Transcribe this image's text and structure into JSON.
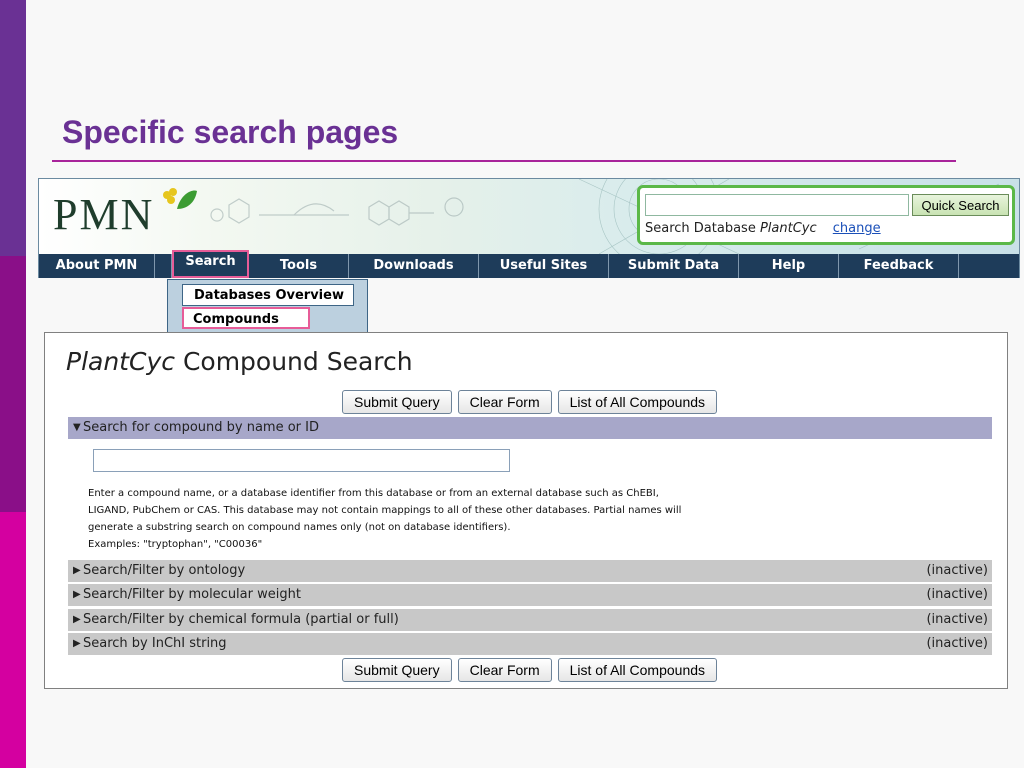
{
  "slide": {
    "title": "Specific search pages"
  },
  "pmn": {
    "logo": "PMN",
    "quick_search": {
      "input_value": "",
      "button_label": "Quick Search",
      "db_prefix": "Search Database",
      "db_name": "PlantCyc",
      "change_label": "change"
    },
    "nav": [
      "About PMN",
      "Search",
      "Tools",
      "Downloads",
      "Useful Sites",
      "Submit Data",
      "Help",
      "Feedback"
    ],
    "dropdown": {
      "item1": "Databases Overview",
      "item2": "Compounds"
    }
  },
  "compound_search": {
    "title_italic": "PlantCyc",
    "title_rest": "Compound Search",
    "buttons": {
      "submit": "Submit Query",
      "clear": "Clear Form",
      "list_all": "List of All Compounds"
    },
    "sections": {
      "name": "Search for compound by name or ID",
      "ontology": "Search/Filter by ontology",
      "weight": "Search/Filter by molecular weight",
      "formula": "Search/Filter by chemical formula (partial or full)",
      "inchi": "Search by InChI string"
    },
    "inactive_label": "(inactive)",
    "name_input_value": "",
    "help_lines": {
      "line1": "Enter a compound name, or a database identifier from this database or from an external database such as ChEBI,",
      "line2": "LIGAND, PubChem or CAS. This database may not contain mappings to all of these other databases. Partial names will",
      "line3": "generate a substring search on compound names only (not on database identifiers).",
      "line4": "Examples: \"tryptophan\", \"C00036\""
    }
  }
}
